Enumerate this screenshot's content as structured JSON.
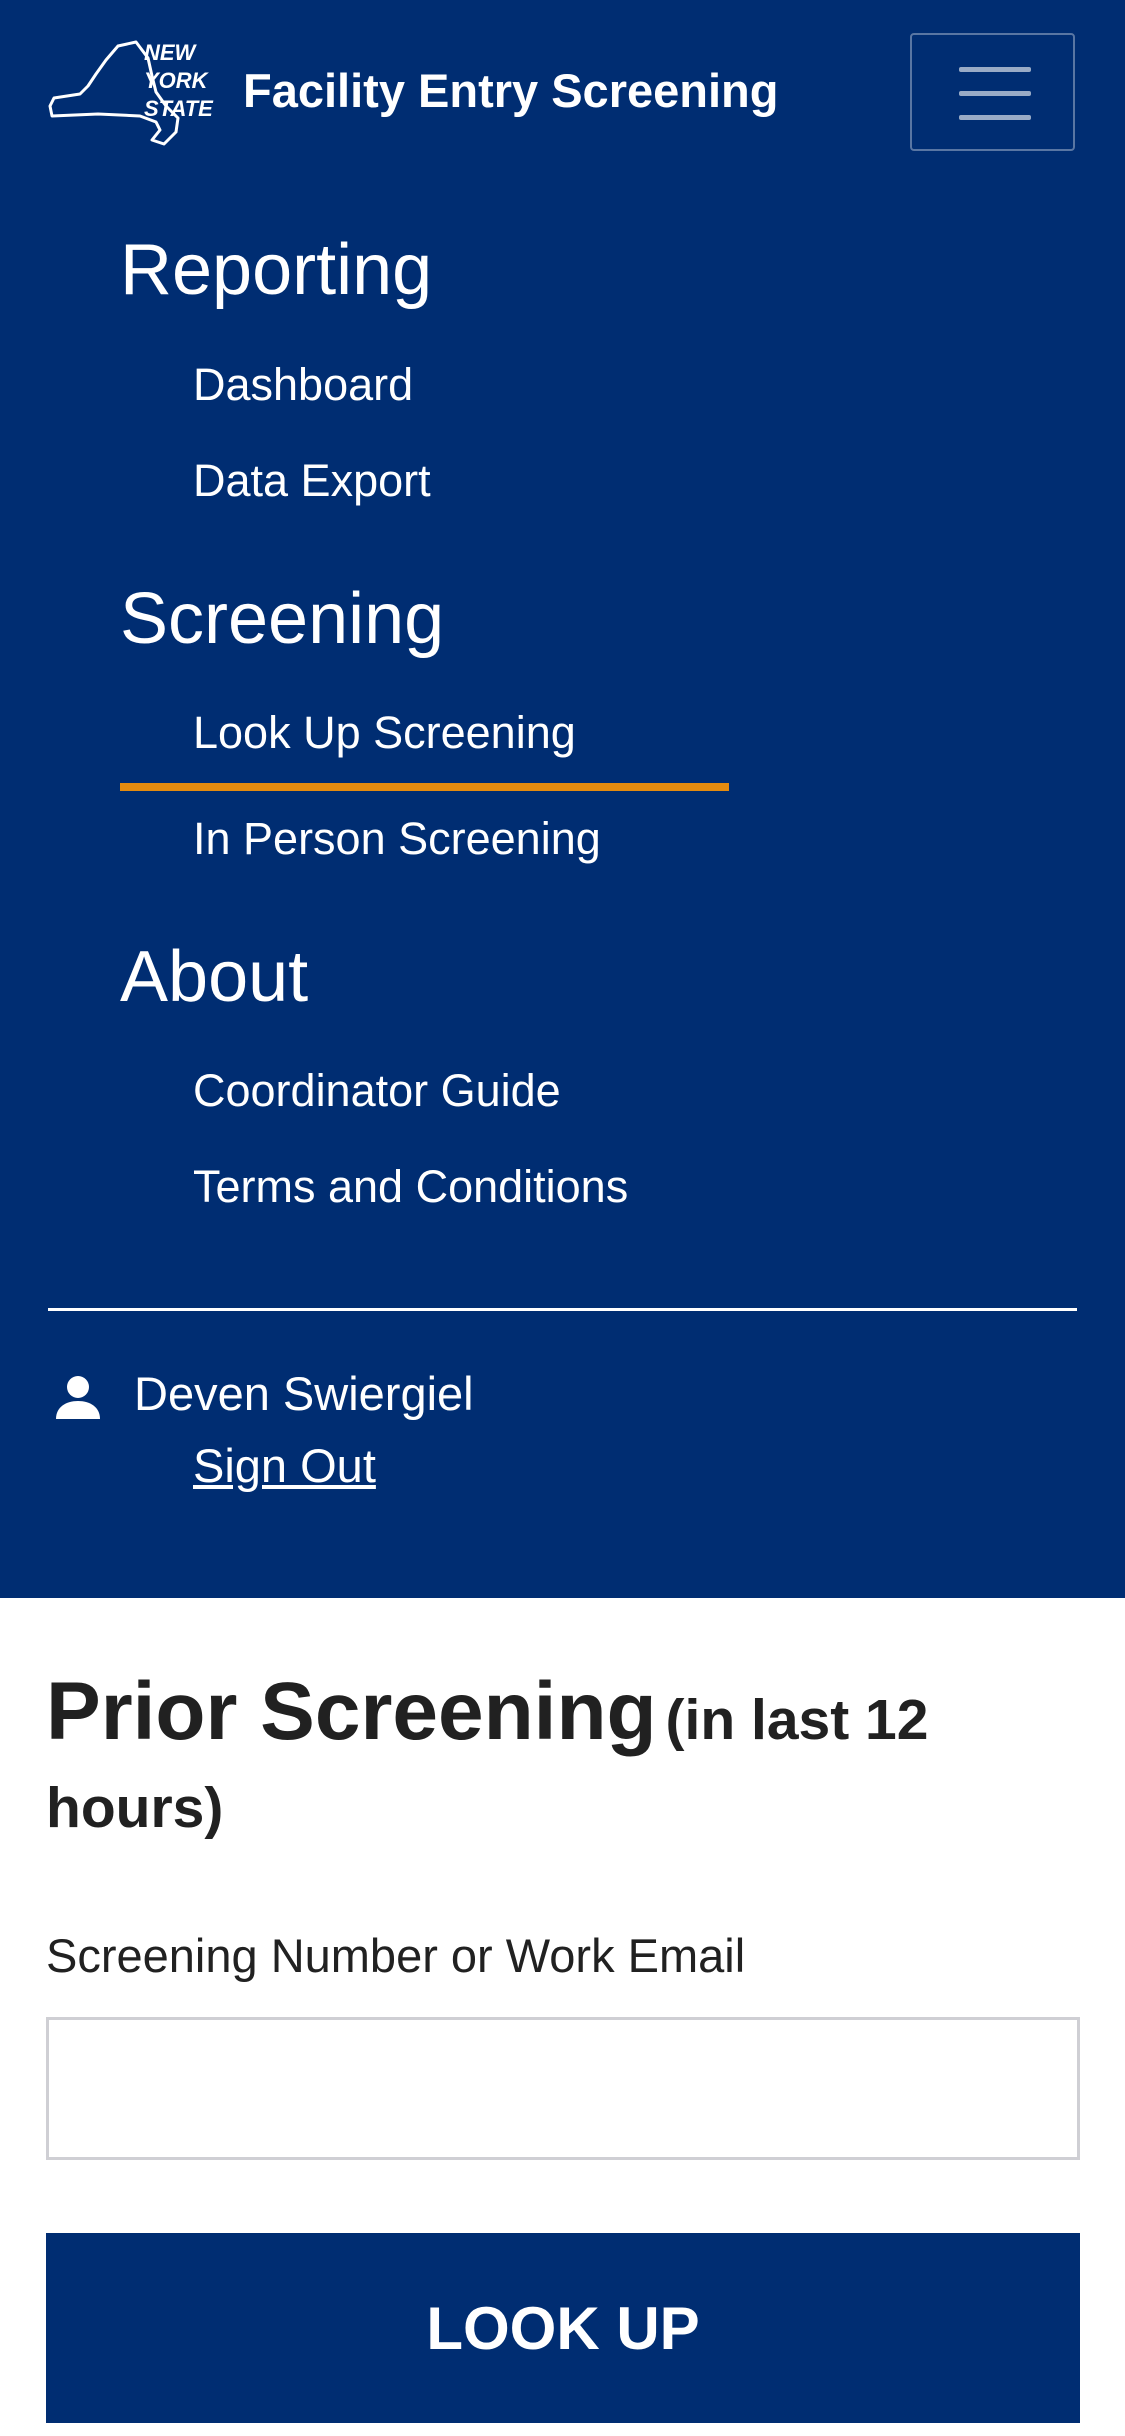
{
  "header": {
    "logo_text": [
      "NEW",
      "YORK",
      "STATE"
    ],
    "app_title": "Facility Entry Screening",
    "menu_icon": "hamburger-menu-icon"
  },
  "nav": {
    "sections": [
      {
        "heading": "Reporting",
        "items": [
          "Dashboard",
          "Data Export"
        ]
      },
      {
        "heading": "Screening",
        "items": [
          "Look Up Screening",
          "In Person Screening"
        ]
      },
      {
        "heading": "About",
        "items": [
          "Coordinator Guide",
          "Terms and Conditions"
        ]
      }
    ],
    "active_item": "Look Up Screening"
  },
  "user": {
    "icon": "person-icon",
    "name": "Deven Swiergiel",
    "sign_out": "Sign Out"
  },
  "main": {
    "title": "Prior Screening",
    "title_qualifier": "(in last 12 hours)",
    "field_label": "Screening Number or Work Email",
    "field_value": "",
    "button_label": "LOOK UP"
  },
  "colors": {
    "nav_background": "#002d72",
    "active_underline": "#e48b0f",
    "button_background": "#002d72",
    "text_dark": "#212121"
  }
}
